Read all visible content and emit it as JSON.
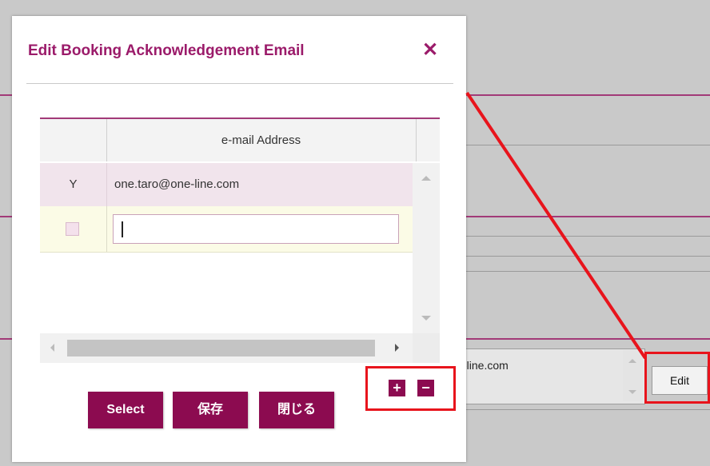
{
  "modal": {
    "title": "Edit Booking Acknowledgement Email",
    "close_glyph": "✕"
  },
  "table": {
    "columns": [
      "",
      "e-mail Address"
    ],
    "rows": [
      {
        "flag": "Y",
        "email": "one.taro@one-line.com"
      },
      {
        "flag": "",
        "email": ""
      }
    ]
  },
  "buttons": {
    "select": "Select",
    "save": "保存",
    "close": "閉じる",
    "add": "+",
    "remove": "−"
  },
  "background": {
    "email_fragment": "-line.com",
    "edit_label": "Edit"
  },
  "colors": {
    "accent": "#9b1b6a",
    "button": "#8c0b50",
    "highlight": "#e8141c"
  },
  "icons": {
    "close": "close-icon",
    "add": "plus-icon",
    "remove": "minus-icon"
  }
}
